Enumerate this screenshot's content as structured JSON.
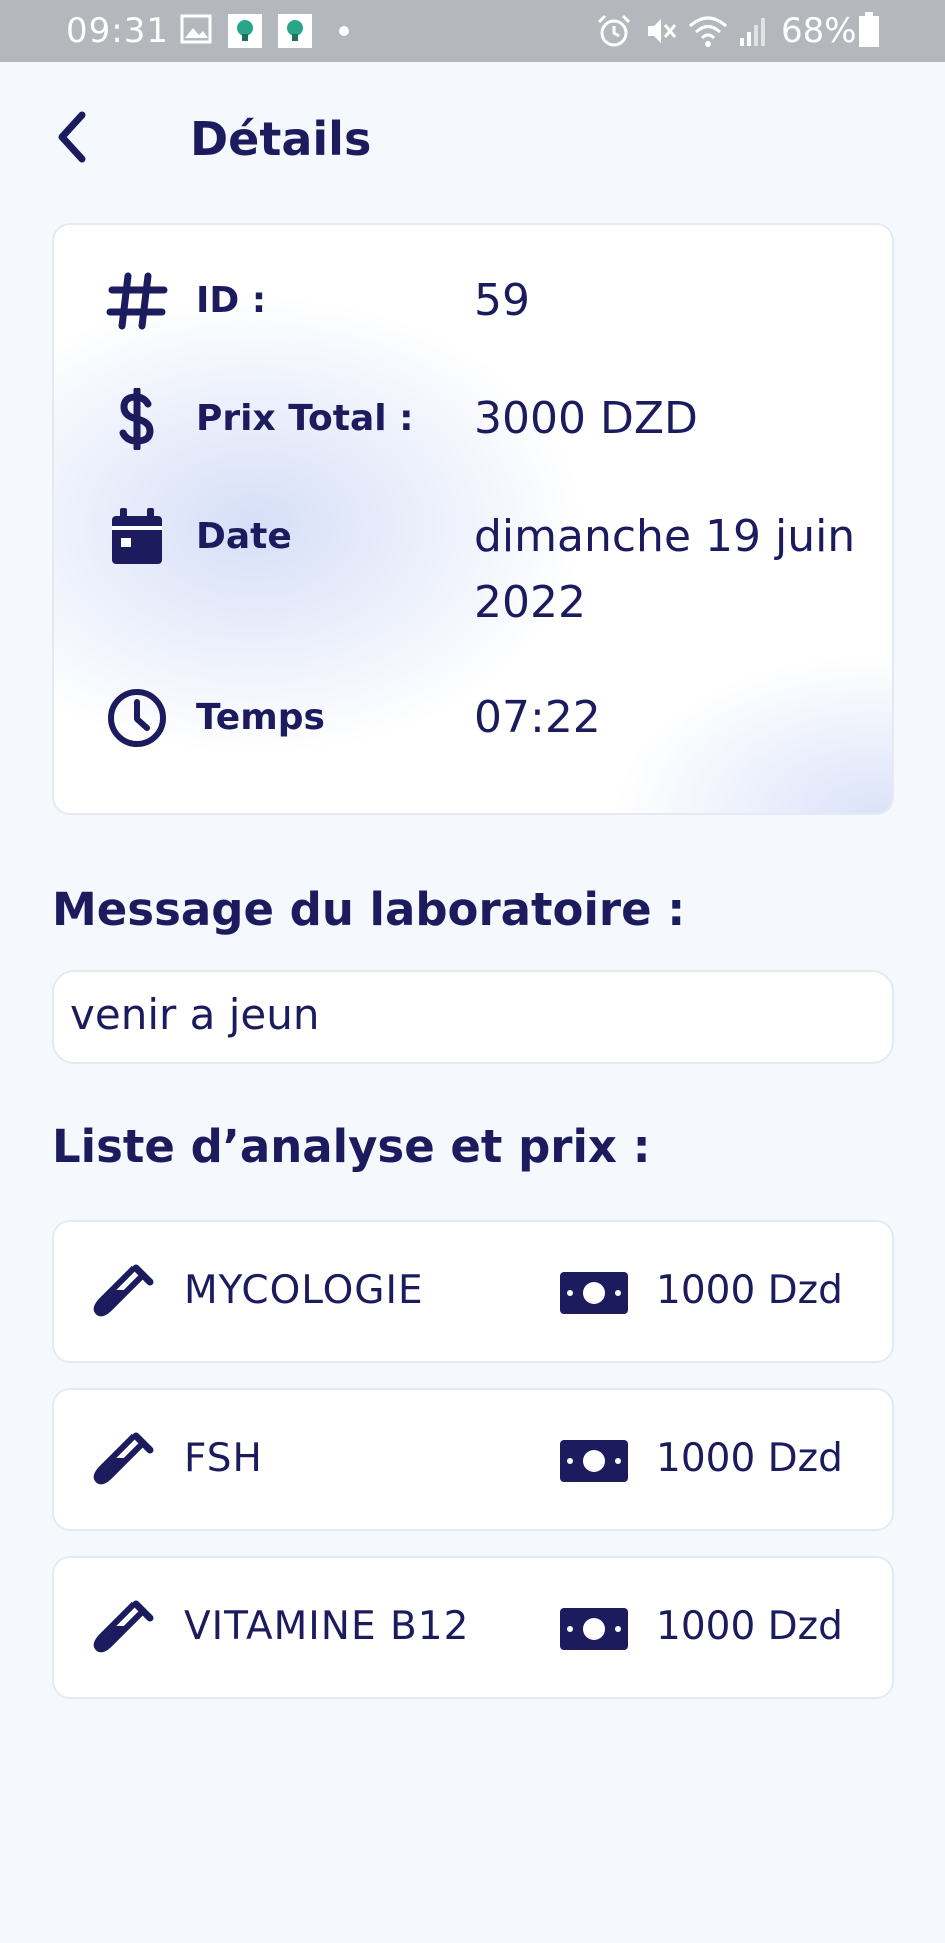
{
  "status_bar": {
    "time": "09:31",
    "battery": "68%",
    "icons": [
      "image-icon",
      "app-notification-icon",
      "app-notification-icon",
      "dot-icon",
      "alarm-icon",
      "mute-icon",
      "wifi-icon",
      "signal-icon",
      "battery-icon"
    ]
  },
  "header": {
    "title": "Détails",
    "back_icon": "chevron-left-icon"
  },
  "info": {
    "id_label": "ID :",
    "id_value": "59",
    "price_label": "Prix Total :",
    "price_value": "3000 DZD",
    "date_label": "Date",
    "date_value": "dimanche 19 juin 2022",
    "time_label": "Temps",
    "time_value": "07:22"
  },
  "message": {
    "title": "Message du laboratoire :",
    "text": "venir a jeun"
  },
  "analyses": {
    "title": "Liste d’analyse et prix  :",
    "items": [
      {
        "name": "MYCOLOGIE",
        "price": "1000 Dzd"
      },
      {
        "name": "FSH",
        "price": "1000 Dzd"
      },
      {
        "name": "VITAMINE B12",
        "price": "1000 Dzd"
      }
    ]
  },
  "colors": {
    "primary": "#1b1b5e",
    "background": "#f5f8fd",
    "status_bar": "#b4b7bc",
    "card": "#ffffff"
  }
}
